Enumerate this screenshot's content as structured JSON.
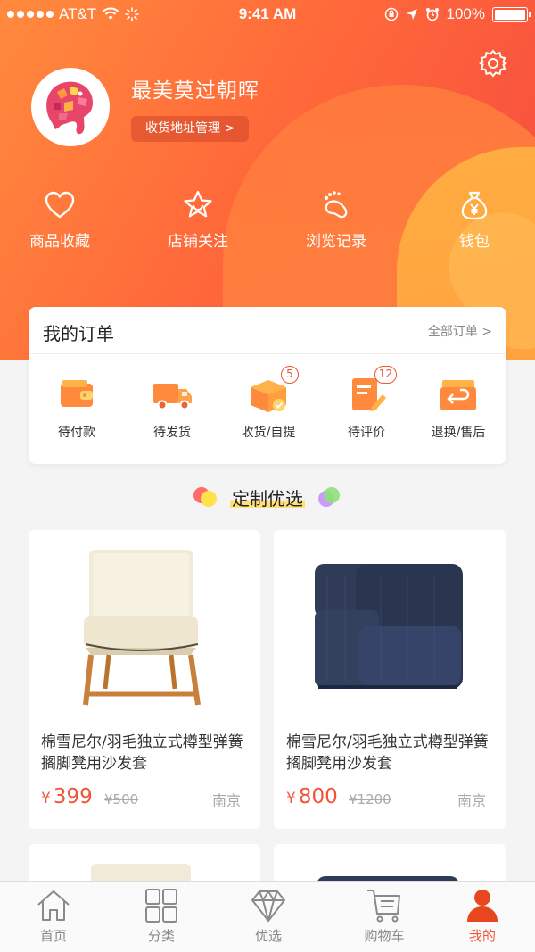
{
  "status_bar": {
    "carrier": "AT&T",
    "time": "9:41 AM",
    "battery": "100%"
  },
  "profile": {
    "username": "最美莫过朝晖",
    "address_button": "收货地址管理 >"
  },
  "quick_entries": [
    {
      "label": "商品收藏",
      "icon": "heart-icon"
    },
    {
      "label": "店铺关注",
      "icon": "star-icon"
    },
    {
      "label": "浏览记录",
      "icon": "footprint-icon"
    },
    {
      "label": "钱包",
      "icon": "money-bag-icon"
    }
  ],
  "orders": {
    "title": "我的订单",
    "view_all": "全部订单 >",
    "items": [
      {
        "label": "待付款",
        "icon": "wallet-icon",
        "badge": ""
      },
      {
        "label": "待发货",
        "icon": "truck-icon",
        "badge": ""
      },
      {
        "label": "收货/自提",
        "icon": "package-icon",
        "badge": "5"
      },
      {
        "label": "待评价",
        "icon": "review-icon",
        "badge": "12"
      },
      {
        "label": "退换/售后",
        "icon": "return-icon",
        "badge": ""
      }
    ]
  },
  "section": {
    "title": "定制优选"
  },
  "products": [
    {
      "name": "棉雪尼尔/羽毛独立式樽型弹簧搁脚凳用沙发套",
      "currency": "¥",
      "price": "399",
      "old_price": "¥500",
      "city": "南京"
    },
    {
      "name": "棉雪尼尔/羽毛独立式樽型弹簧搁脚凳用沙发套",
      "currency": "¥",
      "price": "800",
      "old_price": "¥1200",
      "city": "南京"
    }
  ],
  "tabs": [
    {
      "label": "首页",
      "icon": "home-icon",
      "active": false
    },
    {
      "label": "分类",
      "icon": "category-icon",
      "active": false
    },
    {
      "label": "优选",
      "icon": "diamond-icon",
      "active": false
    },
    {
      "label": "购物车",
      "icon": "cart-icon",
      "active": false
    },
    {
      "label": "我的",
      "icon": "user-icon",
      "active": true
    }
  ],
  "colors": {
    "accent": "#f0553a",
    "header_start": "#ff8a3d",
    "header_end": "#f6493f"
  }
}
